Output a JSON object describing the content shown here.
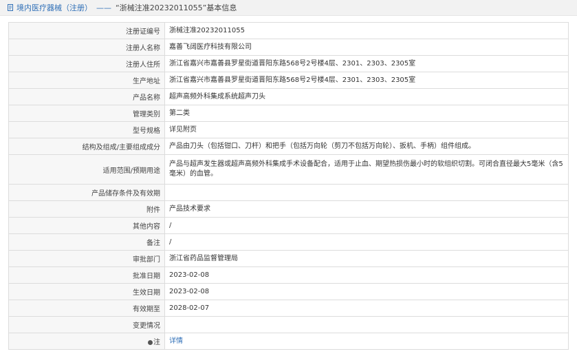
{
  "header": {
    "title_main": "境内医疗器械（注册）",
    "title_dash": "——",
    "title_detail": "“浙械注准20232011055”基本信息"
  },
  "rows": [
    {
      "label": "注册证编号",
      "value": "浙械注准20232011055"
    },
    {
      "label": "注册人名称",
      "value": "嘉善飞阔医疗科技有限公司"
    },
    {
      "label": "注册人住所",
      "value": "浙江省嘉兴市嘉善县罗星街道晋阳东路568号2号楼4层、2301、2303、2305室"
    },
    {
      "label": "生产地址",
      "value": "浙江省嘉兴市嘉善县罗星街道晋阳东路568号2号楼4层、2301、2303、2305室"
    },
    {
      "label": "产品名称",
      "value": "超声高频外科集成系统超声刀头"
    },
    {
      "label": "管理类别",
      "value": "第二类"
    },
    {
      "label": "型号规格",
      "value": "详见附页"
    },
    {
      "label": "结构及组成/主要组成成分",
      "value": "产品由刀头（包括钳口、刀杆）和把手（包括万向轮（剪刀不包括万向轮）、扳机、手柄）组件组成。"
    },
    {
      "label": "适用范围/预期用途",
      "value": "产品与超声发生器或超声高频外科集成手术设备配合，适用于止血、期望热损伤最小时的软组织切割。可闭合直径最大5毫米（含5毫米）的血管。"
    },
    {
      "label": "产品储存条件及有效期",
      "value": ""
    },
    {
      "label": "附件",
      "value": "产品技术要求"
    },
    {
      "label": "其他内容",
      "value": "/"
    },
    {
      "label": "备注",
      "value": "/"
    },
    {
      "label": "审批部门",
      "value": "浙江省药品监督管理局"
    },
    {
      "label": "批准日期",
      "value": "2023-02-08"
    },
    {
      "label": "生效日期",
      "value": "2023-02-08"
    },
    {
      "label": "有效期至",
      "value": "2028-02-07"
    },
    {
      "label": "变更情况",
      "value": ""
    }
  ],
  "note_row": {
    "label": "注",
    "link": "详情"
  },
  "colors": {
    "link": "#2f6fb7",
    "label_bg": "#f7f7f7",
    "border": "#dcdcdc"
  }
}
